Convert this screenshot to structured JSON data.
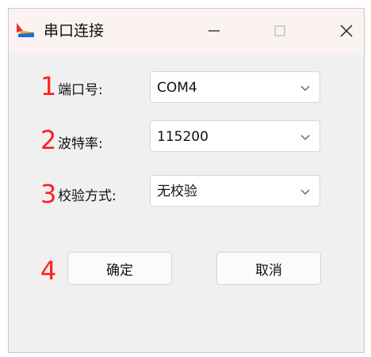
{
  "window": {
    "title": "串口连接",
    "controls": {
      "minimize_icon": "minimize-icon",
      "maximize_icon": "maximize-icon",
      "close_icon": "close-icon"
    }
  },
  "form": {
    "port": {
      "badge": "1",
      "label": "端口号:",
      "value": "COM4"
    },
    "baud": {
      "badge": "2",
      "label": "波特率:",
      "value": "115200"
    },
    "parity": {
      "badge": "3",
      "label": "校验方式:",
      "value": "无校验"
    }
  },
  "buttons": {
    "badge": "4",
    "ok_label": "确定",
    "cancel_label": "取消"
  },
  "colors": {
    "badge": "#ff1f1f",
    "titlebar": "#fbf2f2",
    "window_bg": "#f0f0f0"
  }
}
